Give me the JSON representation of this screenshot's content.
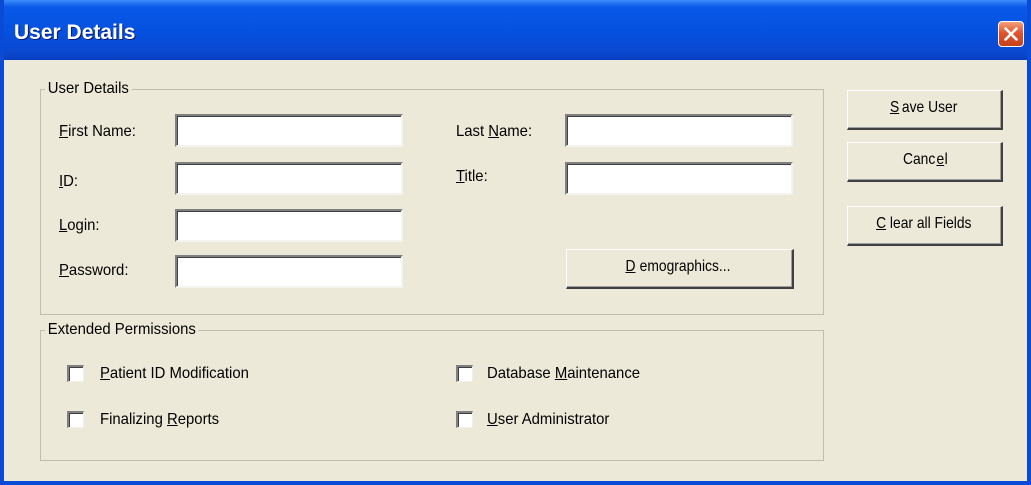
{
  "window": {
    "title": "User Details",
    "close_icon": "close-icon"
  },
  "user_details": {
    "legend": "User Details",
    "first_name": {
      "pre": "",
      "ul": "F",
      "post": "irst Name:",
      "value": ""
    },
    "last_name": {
      "pre": "Last ",
      "ul": "N",
      "post": "ame:",
      "value": ""
    },
    "id": {
      "pre": "",
      "ul": "I",
      "post": "D:",
      "value": ""
    },
    "title": {
      "pre": "",
      "ul": "T",
      "post": "itle:",
      "value": ""
    },
    "login": {
      "pre": "",
      "ul": "L",
      "post": "ogin:",
      "value": ""
    },
    "password": {
      "pre": "",
      "ul": "P",
      "post": "assword:",
      "value": ""
    },
    "demographics": {
      "pre": "",
      "ul": "D",
      "post": "emographics..."
    }
  },
  "extended_permissions": {
    "legend": "Extended Permissions",
    "patient_id": {
      "pre": "",
      "ul": "P",
      "post": "atient ID Modification",
      "checked": false
    },
    "finalizing": {
      "pre": "Finalizing ",
      "ul": "R",
      "post": "eports",
      "checked": false
    },
    "database": {
      "pre": "Database ",
      "ul": "M",
      "post": "aintenance",
      "checked": false
    },
    "user_admin": {
      "pre": "",
      "ul": "U",
      "post": "ser Administrator",
      "checked": false
    }
  },
  "buttons": {
    "save": {
      "pre": "",
      "ul": "S",
      "post": "ave User"
    },
    "cancel": {
      "pre": "Canc",
      "ul": "e",
      "post": "l"
    },
    "clear": {
      "pre": "",
      "ul": "C",
      "post": "lear all Fields"
    }
  },
  "colors": {
    "title_bar": "#0550de",
    "face": "#ece9d8",
    "close": "#e0552e"
  }
}
